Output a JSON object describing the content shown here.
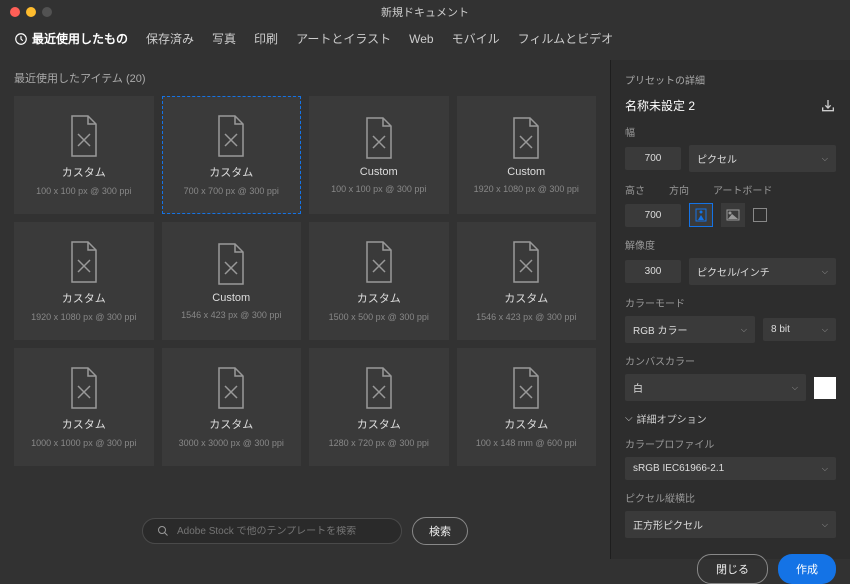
{
  "window": {
    "title": "新規ドキュメント"
  },
  "tabs": [
    {
      "label": "最近使用したもの",
      "active": true,
      "icon": "recent"
    },
    {
      "label": "保存済み"
    },
    {
      "label": "写真"
    },
    {
      "label": "印刷"
    },
    {
      "label": "アートとイラスト"
    },
    {
      "label": "Web"
    },
    {
      "label": "モバイル"
    },
    {
      "label": "フィルムとビデオ"
    }
  ],
  "recent": {
    "header": "最近使用したアイテム (20)",
    "items": [
      {
        "title": "カスタム",
        "sub": "100 x 100 px @ 300 ppi"
      },
      {
        "title": "カスタム",
        "sub": "700 x 700 px @ 300 ppi",
        "selected": true
      },
      {
        "title": "Custom",
        "sub": "100 x 100 px @ 300 ppi"
      },
      {
        "title": "Custom",
        "sub": "1920 x 1080 px @ 300 ppi"
      },
      {
        "title": "カスタム",
        "sub": "1920 x 1080 px @ 300 ppi"
      },
      {
        "title": "Custom",
        "sub": "1546 x 423 px @ 300 ppi"
      },
      {
        "title": "カスタム",
        "sub": "1500 x 500 px @ 300 ppi"
      },
      {
        "title": "カスタム",
        "sub": "1546 x 423 px @ 300 ppi"
      },
      {
        "title": "カスタム",
        "sub": "1000 x 1000 px @ 300 ppi"
      },
      {
        "title": "カスタム",
        "sub": "3000 x 3000 px @ 300 ppi"
      },
      {
        "title": "カスタム",
        "sub": "1280 x 720 px @ 300 ppi"
      },
      {
        "title": "カスタム",
        "sub": "100 x 148 mm @ 600 ppi"
      }
    ]
  },
  "search": {
    "placeholder": "Adobe Stock で他のテンプレートを検索",
    "go": "検索"
  },
  "preset": {
    "header": "プリセットの詳細",
    "name": "名称未設定 2",
    "width_label": "幅",
    "width": "700",
    "unit": "ピクセル",
    "height_label": "高さ",
    "orient_label": "方向",
    "artboard_label": "アートボード",
    "height": "700",
    "res_label": "解像度",
    "res": "300",
    "res_unit": "ピクセル/インチ",
    "mode_label": "カラーモード",
    "mode": "RGB カラー",
    "bits": "8 bit",
    "bg_label": "カンバスカラー",
    "bg": "白",
    "adv": "詳細オプション",
    "profile_label": "カラープロファイル",
    "profile": "sRGB IEC61966-2.1",
    "aspect_label": "ピクセル縦横比",
    "aspect": "正方形ピクセル"
  },
  "footer": {
    "close": "閉じる",
    "create": "作成"
  }
}
